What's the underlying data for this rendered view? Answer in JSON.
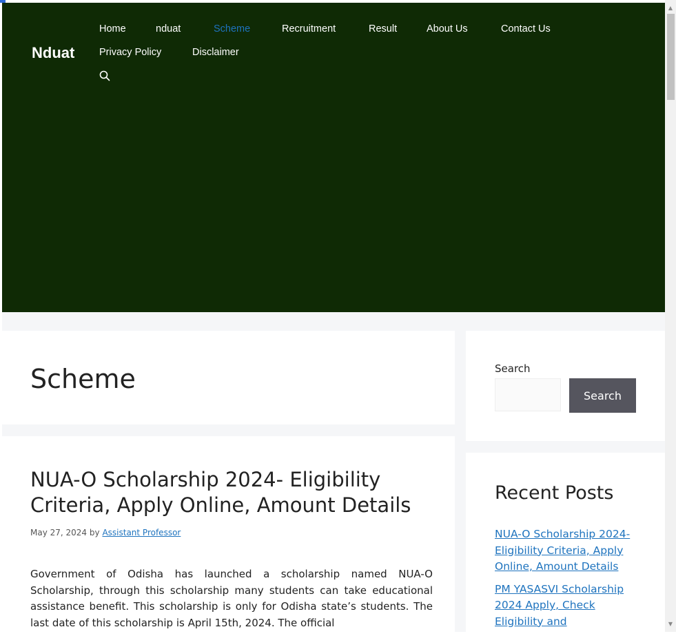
{
  "site": {
    "logo": "Nduat"
  },
  "nav": {
    "items": [
      {
        "label": "Home"
      },
      {
        "label": "nduat"
      },
      {
        "label": "Scheme"
      },
      {
        "label": "Recruitment"
      },
      {
        "label": "Result"
      },
      {
        "label": "About Us"
      },
      {
        "label": "Contact Us"
      },
      {
        "label": "Privacy Policy"
      },
      {
        "label": "Disclaimer"
      }
    ],
    "current": "Scheme",
    "search_icon": "search-icon"
  },
  "archive": {
    "title": "Scheme"
  },
  "post": {
    "title": "NUA-O Scholarship 2024- Eligibility Criteria, Apply Online, Amount Details",
    "date": "May 27, 2024",
    "by": "by",
    "author": "Assistant Professor",
    "excerpt": "Government of Odisha has launched a scholarship named NUA-O Scholarship, through this scholarship many students can take educational assistance benefit. This scholarship is only for Odisha state’s students. The last date of this scholarship is April 15th, 2024. The official"
  },
  "sidebar": {
    "search": {
      "label": "Search",
      "button": "Search",
      "placeholder": ""
    },
    "recent": {
      "title": "Recent Posts",
      "items": [
        {
          "label": "NUA-O Scholarship 2024- Eligibility Criteria, Apply Online, Amount Details"
        },
        {
          "label": "PM YASASVI Scholarship 2024 Apply, Check Eligibility and"
        }
      ]
    }
  },
  "colors": {
    "header_bg": "#0f2a05",
    "nav_active": "#1e73be",
    "link": "#1e73be",
    "button_bg": "#55555e",
    "content_bg": "#f5f6f8"
  }
}
